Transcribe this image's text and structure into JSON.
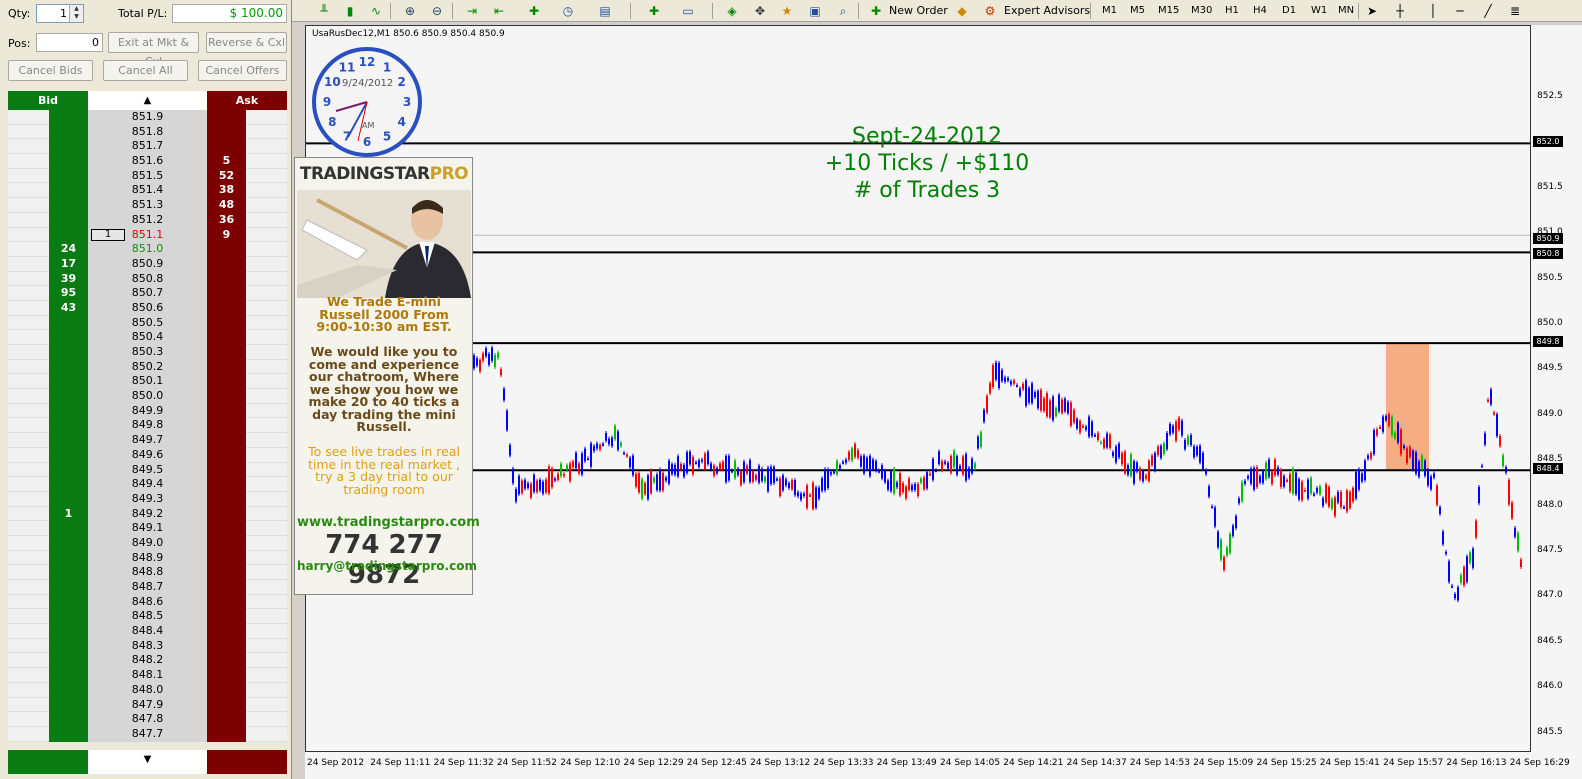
{
  "dom": {
    "qty_label": "Qty:",
    "qty_value": "1",
    "total_pl_label": "Total P/L:",
    "total_pl_value": "$ 100.00",
    "pos_label": "Pos:",
    "pos_value": "0",
    "exit_btn": "Exit at Mkt & Cxl",
    "reverse_btn": "Reverse & Cxl",
    "cancel_bids": "Cancel Bids",
    "cancel_all": "Cancel All",
    "cancel_offers": "Cancel Offers",
    "bid_header": "Bid",
    "ask_header": "Ask",
    "scroll_up": "▲",
    "scroll_down": "▼",
    "colors": {
      "bid": "#0a7a12",
      "ask": "#7d0000",
      "last_price": "#e00000",
      "bid_price": "#109010"
    },
    "ladder": [
      {
        "price": "851.9",
        "bid": "",
        "ask": ""
      },
      {
        "price": "851.8",
        "bid": "",
        "ask": ""
      },
      {
        "price": "851.7",
        "bid": "",
        "ask": ""
      },
      {
        "price": "851.6",
        "bid": "",
        "ask": "5"
      },
      {
        "price": "851.5",
        "bid": "",
        "ask": "52"
      },
      {
        "price": "851.4",
        "bid": "",
        "ask": "38"
      },
      {
        "price": "851.3",
        "bid": "",
        "ask": "48"
      },
      {
        "price": "851.2",
        "bid": "",
        "ask": "36"
      },
      {
        "price": "851.1",
        "bid": "",
        "ask": "9",
        "order": "1",
        "style": "last"
      },
      {
        "price": "851.0",
        "bid": "24",
        "ask": "",
        "style": "bid"
      },
      {
        "price": "850.9",
        "bid": "17",
        "ask": ""
      },
      {
        "price": "850.8",
        "bid": "39",
        "ask": ""
      },
      {
        "price": "850.7",
        "bid": "95",
        "ask": ""
      },
      {
        "price": "850.6",
        "bid": "43",
        "ask": ""
      },
      {
        "price": "850.5",
        "bid": "",
        "ask": ""
      },
      {
        "price": "850.4",
        "bid": "",
        "ask": ""
      },
      {
        "price": "850.3",
        "bid": "",
        "ask": ""
      },
      {
        "price": "850.2",
        "bid": "",
        "ask": ""
      },
      {
        "price": "850.1",
        "bid": "",
        "ask": ""
      },
      {
        "price": "850.0",
        "bid": "",
        "ask": ""
      },
      {
        "price": "849.9",
        "bid": "",
        "ask": ""
      },
      {
        "price": "849.8",
        "bid": "",
        "ask": ""
      },
      {
        "price": "849.7",
        "bid": "",
        "ask": ""
      },
      {
        "price": "849.6",
        "bid": "",
        "ask": ""
      },
      {
        "price": "849.5",
        "bid": "",
        "ask": ""
      },
      {
        "price": "849.4",
        "bid": "",
        "ask": ""
      },
      {
        "price": "849.3",
        "bid": "",
        "ask": ""
      },
      {
        "price": "849.2",
        "bid": "1",
        "ask": ""
      },
      {
        "price": "849.1",
        "bid": "",
        "ask": ""
      },
      {
        "price": "849.0",
        "bid": "",
        "ask": ""
      },
      {
        "price": "848.9",
        "bid": "",
        "ask": ""
      },
      {
        "price": "848.8",
        "bid": "",
        "ask": ""
      },
      {
        "price": "848.7",
        "bid": "",
        "ask": ""
      },
      {
        "price": "848.6",
        "bid": "",
        "ask": ""
      },
      {
        "price": "848.5",
        "bid": "",
        "ask": ""
      },
      {
        "price": "848.4",
        "bid": "",
        "ask": ""
      },
      {
        "price": "848.3",
        "bid": "",
        "ask": ""
      },
      {
        "price": "848.2",
        "bid": "",
        "ask": ""
      },
      {
        "price": "848.1",
        "bid": "",
        "ask": ""
      },
      {
        "price": "848.0",
        "bid": "",
        "ask": ""
      },
      {
        "price": "847.9",
        "bid": "",
        "ask": ""
      },
      {
        "price": "847.8",
        "bid": "",
        "ask": ""
      },
      {
        "price": "847.7",
        "bid": "",
        "ask": ""
      }
    ]
  },
  "toolbar": {
    "new_order": "New Order",
    "expert_advisors": "Expert Advisors",
    "timeframes": [
      "M1",
      "M5",
      "M15",
      "M30",
      "H1",
      "H4",
      "D1",
      "W1",
      "MN"
    ]
  },
  "chart": {
    "symbol_line": "UsaRusDec12,M1  850.6 850.9 850.4 850.9",
    "clock_date": "9/24/2012",
    "clock_am": "AM",
    "annotation": [
      "Sept-24-2012",
      "+10 Ticks / +$110",
      "# of Trades 3"
    ],
    "y_labels": [
      "852.5",
      "851.5",
      "851.0",
      "850.5",
      "850.0",
      "849.5",
      "849.0",
      "848.5",
      "848.0",
      "847.5",
      "847.0",
      "846.5",
      "846.0",
      "845.5"
    ],
    "y_tags": [
      "852.0",
      "850.9",
      "850.8",
      "849.8",
      "848.4"
    ],
    "x_labels": [
      "24 Sep 2012",
      "24 Sep 11:11",
      "24 Sep 11:32",
      "24 Sep 11:52",
      "24 Sep 12:10",
      "24 Sep 12:29",
      "24 Sep 12:45",
      "24 Sep 13:12",
      "24 Sep 13:33",
      "24 Sep 13:49",
      "24 Sep 14:05",
      "24 Sep 14:21",
      "24 Sep 14:37",
      "24 Sep 14:53",
      "24 Sep 15:09",
      "24 Sep 15:25",
      "24 Sep 15:41",
      "24 Sep 15:57",
      "24 Sep 16:13",
      "24 Sep 16:29"
    ],
    "levels": [
      "852.0",
      "850.8",
      "849.8",
      "848.4"
    ],
    "colors": {
      "up": "#0000ff",
      "down": "#ff0000",
      "doji": "#00c000",
      "zone": "#f4a070",
      "annotation": "#008000"
    }
  },
  "ad": {
    "logo_a": "TRADINGSTAR",
    "logo_b": "PRO",
    "line1": "We Trade E-mini Russell 2000 From 9:00-10:30 am EST.",
    "line2": "We would like you to come and experience our chatroom, Where we show you how we make 20 to 40 ticks a day trading the mini Russell.",
    "line3": "To see live trades in real time in the real market , try a 3 day trial to our trading room",
    "url": "www.tradingstarpro.com",
    "phone": "774 277 9872",
    "email": "harry@tradingstarpro.com"
  }
}
